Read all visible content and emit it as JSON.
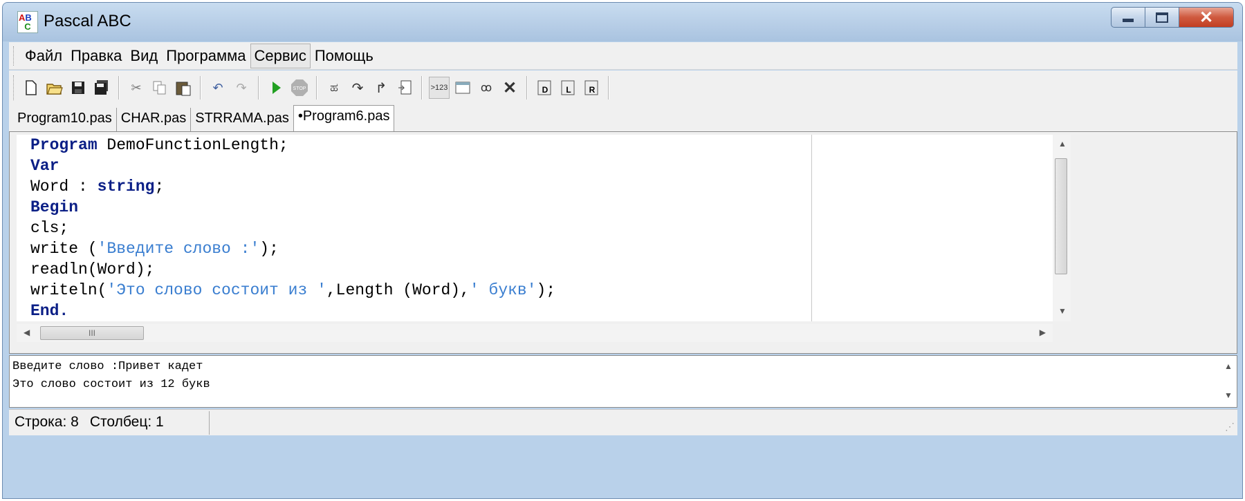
{
  "window": {
    "title": "Pascal ABC",
    "icon": "pascal-abc-app-icon",
    "controls": [
      "minimize",
      "maximize",
      "close"
    ]
  },
  "menu": {
    "items": [
      {
        "label": "Файл"
      },
      {
        "label": "Правка"
      },
      {
        "label": "Вид"
      },
      {
        "label": "Программа"
      },
      {
        "label": "Сервис",
        "active": true
      },
      {
        "label": "Помощь"
      }
    ]
  },
  "toolbar": {
    "icons": [
      "new-file-icon",
      "open-file-icon",
      "save-icon",
      "save-all-icon",
      "cut-icon",
      "copy-icon",
      "paste-icon",
      "undo-icon",
      "redo-icon",
      "run-icon",
      "stop-icon",
      "step-into-icon",
      "step-over-icon",
      "step-out-icon",
      "watch-icon",
      "output-window-icon",
      "immediate-window-icon",
      "debug-view-icon",
      "close-debug-icon",
      "go-to-d-icon",
      "go-to-l-icon",
      "go-to-r-icon"
    ]
  },
  "tabs": [
    {
      "label": "Program10.pas"
    },
    {
      "label": "CHAR.pas"
    },
    {
      "label": "STRRAMA.pas"
    },
    {
      "label": "•Program6.pas",
      "active": true
    }
  ],
  "editor": {
    "lines": [
      {
        "kw": "Program",
        "rest": " DemoFunctionLength;"
      },
      {
        "kw": "Var",
        "rest": ""
      },
      {
        "pre": "Word : ",
        "kw": "string",
        "rest": ";"
      },
      {
        "kw": "Begin",
        "rest": ""
      },
      {
        "pre": "cls;"
      },
      {
        "pre": "write (",
        "str": "'Введите слово :'",
        "rest": ");"
      },
      {
        "pre": "readln(Word);"
      },
      {
        "pre": "writeln(",
        "str": "'Это слово состоит из '",
        "mid": ",Length (Word),",
        "str2": "' букв'",
        "rest": ");"
      },
      {
        "kw": "End",
        "rest": "."
      }
    ]
  },
  "output": {
    "lines": [
      "Введите слово :Привет кадет",
      "Это слово состоит из 12 букв"
    ]
  },
  "status": {
    "line_label": "Строка: 8",
    "col_label": "Столбец: 1"
  }
}
